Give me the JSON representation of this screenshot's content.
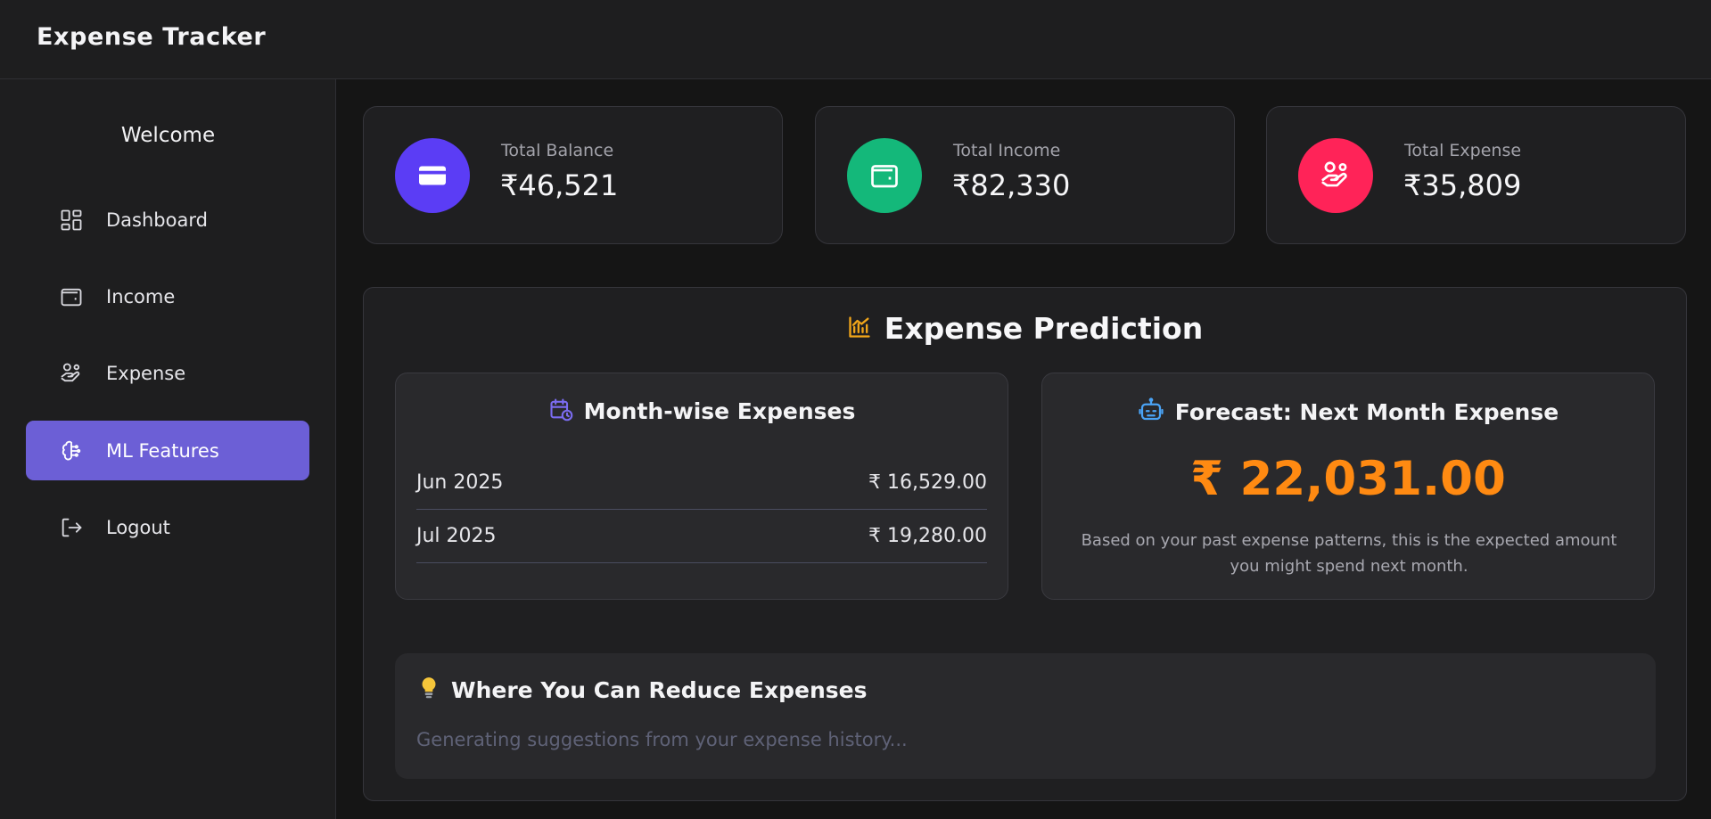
{
  "app": {
    "title": "Expense Tracker"
  },
  "sidebar": {
    "welcome": "Welcome",
    "items": [
      {
        "label": "Dashboard",
        "icon": "dashboard-icon",
        "active": false
      },
      {
        "label": "Income",
        "icon": "wallet-icon",
        "active": false
      },
      {
        "label": "Expense",
        "icon": "hand-coins-icon",
        "active": false
      },
      {
        "label": "ML Features",
        "icon": "brain-icon",
        "active": true
      },
      {
        "label": "Logout",
        "icon": "logout-icon",
        "active": false
      }
    ]
  },
  "stats": [
    {
      "label": "Total Balance",
      "value": "₹46,521",
      "color": "#5b3df5",
      "icon": "credit-card-icon"
    },
    {
      "label": "Total Income",
      "value": "₹82,330",
      "color": "#14b87a",
      "icon": "wallet-icon"
    },
    {
      "label": "Total Expense",
      "value": "₹35,809",
      "color": "#ff2358",
      "icon": "hand-coins-icon"
    }
  ],
  "prediction": {
    "title": "Expense Prediction",
    "icon": "chart-icon",
    "month_wise": {
      "title": "Month-wise Expenses",
      "icon": "calendar-clock-icon",
      "rows": [
        {
          "month": "Jun 2025",
          "amount": "₹ 16,529.00"
        },
        {
          "month": "Jul 2025",
          "amount": "₹ 19,280.00"
        }
      ]
    },
    "forecast": {
      "title": "Forecast: Next Month Expense",
      "icon": "robot-icon",
      "amount": "₹ 22,031.00",
      "description": "Based on your past expense patterns, this is the expected amount you might spend next month."
    },
    "reduce": {
      "title": "Where You Can Reduce Expenses",
      "icon": "lightbulb-icon",
      "status": "Generating suggestions from your expense history..."
    }
  },
  "colors": {
    "accent": "#6c5fd6",
    "forecast": "#ff8a12",
    "chart_icon": "#f0a51a",
    "calendar_icon": "#7b6cf0",
    "robot_icon": "#4aa3f5"
  }
}
